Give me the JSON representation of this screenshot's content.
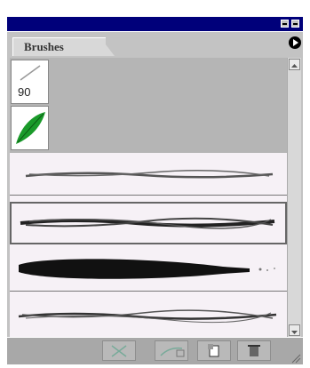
{
  "panel": {
    "tab_label": "Brushes",
    "preset_size_label": "90"
  },
  "icons": {
    "titlebar_min": "minimize-icon",
    "titlebar_close": "close-icon",
    "panel_menu": "panel-menu-arrow-icon",
    "scroll_up": "scroll-up-arrow-icon",
    "scroll_down": "scroll-down-arrow-icon",
    "bottom_buttons": [
      "remove-stroke-icon",
      "options-icon",
      "new-brush-icon",
      "delete-brush-icon"
    ],
    "resize": "resize-grip-icon"
  },
  "colors": {
    "titlebar": "#00007a",
    "leaf_green": "#1a9a2a",
    "panel_bg": "#c3c3c3",
    "stroke_list_bg": "#f6f1f6"
  }
}
